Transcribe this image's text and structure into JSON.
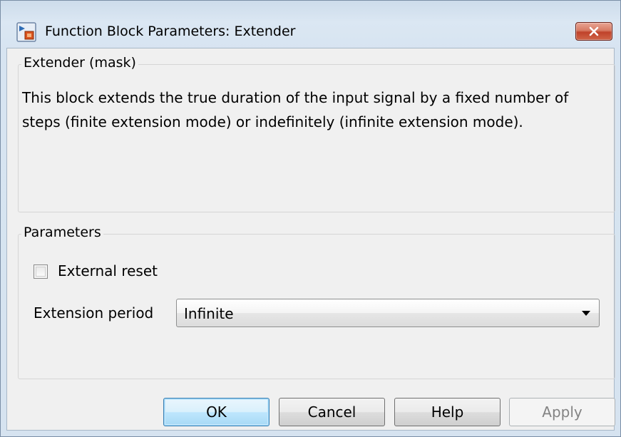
{
  "window": {
    "title": "Function Block Parameters: Extender",
    "app_icon": "simulink-block-icon",
    "close_icon": "close-icon"
  },
  "description_group": {
    "legend": "Extender (mask)",
    "text": "This block extends the true duration of the input signal by a fixed number of steps (finite extension mode) or indefinitely (infinite extension mode)."
  },
  "parameters_group": {
    "legend": "Parameters",
    "external_reset": {
      "label": "External reset",
      "checked": false
    },
    "extension_period": {
      "label": "Extension period",
      "value": "Infinite"
    }
  },
  "buttons": {
    "ok": "OK",
    "cancel": "Cancel",
    "help": "Help",
    "apply": "Apply"
  },
  "colors": {
    "default_button_border": "#3c7fb1",
    "close_button": "#c0422a"
  }
}
